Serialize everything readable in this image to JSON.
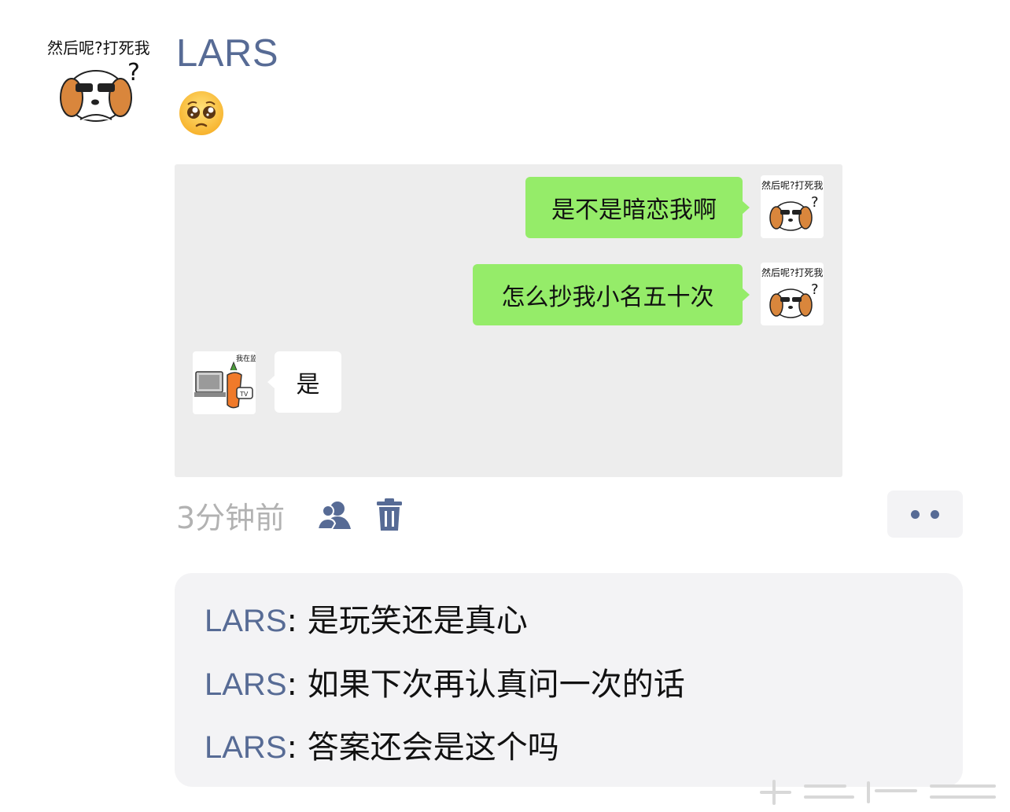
{
  "post": {
    "username": "LARS",
    "emoji": "🥺",
    "avatar_caption": "然后呢?打死我"
  },
  "chat_screenshot": {
    "messages": [
      {
        "side": "right",
        "text": "是不是暗恋我啊",
        "avatar_caption": "然后呢?打死我"
      },
      {
        "side": "right",
        "text": "怎么抄我小名五十次",
        "avatar_caption": "然后呢?打死我"
      },
      {
        "side": "left",
        "text": "是",
        "avatar_caption": "我在监牢"
      }
    ]
  },
  "actions": {
    "timestamp": "3分钟前",
    "icons": [
      "contacts-visibility-icon",
      "trash-icon",
      "more-dots-icon"
    ]
  },
  "comments": [
    {
      "author": "LARS",
      "sep": ": ",
      "text": "是玩笑还是真心"
    },
    {
      "author": "LARS",
      "sep": ": ",
      "text": "如果下次再认真问一次的话"
    },
    {
      "author": "LARS",
      "sep": ": ",
      "text": "答案还会是这个吗"
    }
  ],
  "colors": {
    "link_blue": "#576b95",
    "bubble_green": "#95ec69",
    "card_gray": "#ededed",
    "comment_bg": "#f3f3f5"
  }
}
